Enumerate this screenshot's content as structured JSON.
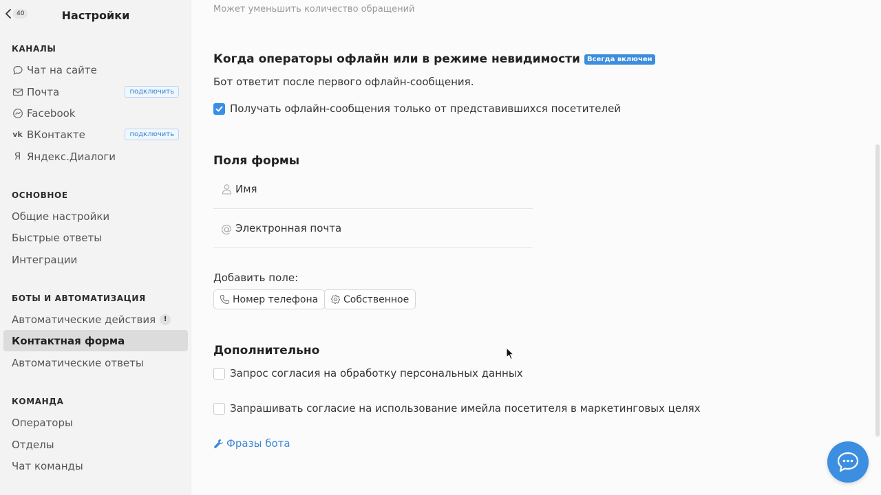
{
  "sidebar": {
    "back_badge": "40",
    "title": "Настройки",
    "sections": {
      "channels": {
        "title": "КАНАЛЫ",
        "items": [
          {
            "label": "Чат на сайте",
            "icon": "chat-icon"
          },
          {
            "label": "Почта",
            "icon": "mail-icon",
            "badge": "подключить"
          },
          {
            "label": "Facebook",
            "icon": "messenger-icon"
          },
          {
            "label": "ВКонтакте",
            "icon": "vk-icon",
            "badge": "подключить"
          },
          {
            "label": "Яндекс.Диалоги",
            "icon": "yandex-icon"
          }
        ]
      },
      "main": {
        "title": "ОСНОВНОЕ",
        "items": [
          {
            "label": "Общие настройки"
          },
          {
            "label": "Быстрые ответы"
          },
          {
            "label": "Интеграции"
          }
        ]
      },
      "bots": {
        "title": "БОТЫ И АВТОМАТИЗАЦИЯ",
        "items": [
          {
            "label": "Автоматические действия",
            "badge": "!"
          },
          {
            "label": "Контактная форма",
            "active": true
          },
          {
            "label": "Автоматические ответы"
          }
        ]
      },
      "team": {
        "title": "КОМАНДА",
        "items": [
          {
            "label": "Операторы"
          },
          {
            "label": "Отделы"
          },
          {
            "label": "Чат команды"
          }
        ]
      }
    }
  },
  "main": {
    "top_note": "Может уменьшить количество обращений",
    "offline": {
      "title": "Когда операторы офлайн или в режиме невидимости",
      "pill": "Всегда включен",
      "description": "Бот ответит после первого офлайн-сообщения.",
      "checkbox_label": "Получать офлайн-сообщения только от представившихся посетителей",
      "checked": true
    },
    "form_fields": {
      "title": "Поля формы",
      "fields": [
        {
          "label": "Имя",
          "icon": "user-icon"
        },
        {
          "label": "Электронная почта",
          "icon": "at-icon"
        }
      ],
      "add_label": "Добавить поле:",
      "add_buttons": [
        {
          "label": "Номер телефона",
          "icon": "phone-icon"
        },
        {
          "label": "Собственное",
          "icon": "gear-icon"
        }
      ]
    },
    "extra": {
      "title": "Дополнительно",
      "options": [
        {
          "label": "Запрос согласия на обработку персональных данных",
          "checked": false
        },
        {
          "label": "Запрашивать согласие на использование имейла посетителя в маркетинговых целях",
          "checked": false
        }
      ]
    },
    "bot_phrases_link": "Фразы бота"
  },
  "colors": {
    "accent": "#3a8ee6",
    "sidebar_bg": "#f3f3f3",
    "active_item_bg": "#dcdcdc"
  }
}
